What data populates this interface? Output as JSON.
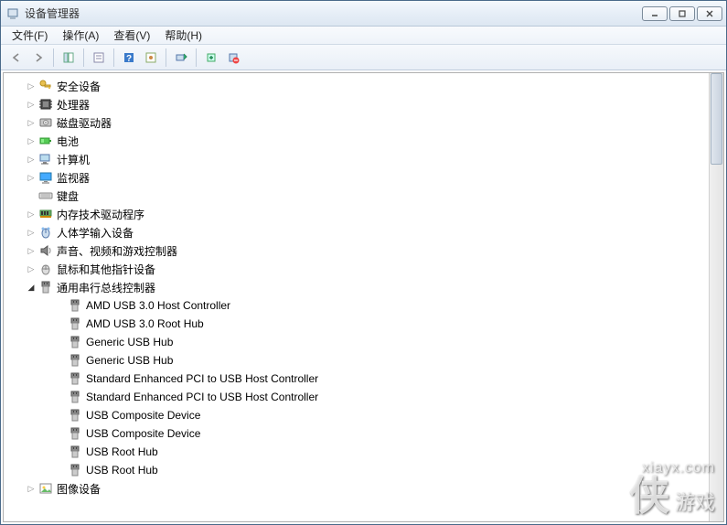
{
  "window": {
    "title": "设备管理器"
  },
  "menu": {
    "file": "文件(F)",
    "action": "操作(A)",
    "view": "查看(V)",
    "help": "帮助(H)"
  },
  "tree": {
    "categories": [
      {
        "icon": "key",
        "label": "安全设备",
        "expandable": true
      },
      {
        "icon": "cpu",
        "label": "处理器",
        "expandable": true
      },
      {
        "icon": "disk",
        "label": "磁盘驱动器",
        "expandable": true
      },
      {
        "icon": "battery",
        "label": "电池",
        "expandable": true
      },
      {
        "icon": "computer",
        "label": "计算机",
        "expandable": true
      },
      {
        "icon": "monitor",
        "label": "监视器",
        "expandable": true
      },
      {
        "icon": "keyboard",
        "label": "键盘",
        "expandable": false
      },
      {
        "icon": "memory",
        "label": "内存技术驱动程序",
        "expandable": true
      },
      {
        "icon": "hid",
        "label": "人体学输入设备",
        "expandable": true
      },
      {
        "icon": "sound",
        "label": "声音、视频和游戏控制器",
        "expandable": true
      },
      {
        "icon": "mouse",
        "label": "鼠标和其他指针设备",
        "expandable": true
      },
      {
        "icon": "usb",
        "label": "通用串行总线控制器",
        "expandable": true,
        "expanded": true,
        "children": [
          "AMD USB 3.0 Host Controller",
          "AMD USB 3.0 Root Hub",
          "Generic USB Hub",
          "Generic USB Hub",
          "Standard Enhanced PCI to USB Host Controller",
          "Standard Enhanced PCI to USB Host Controller",
          "USB Composite Device",
          "USB Composite Device",
          "USB Root Hub",
          "USB Root Hub"
        ]
      },
      {
        "icon": "image",
        "label": "图像设备",
        "expandable": true
      }
    ]
  },
  "watermark": {
    "url": "xiayx.com",
    "big": "侠",
    "small": "游戏"
  }
}
